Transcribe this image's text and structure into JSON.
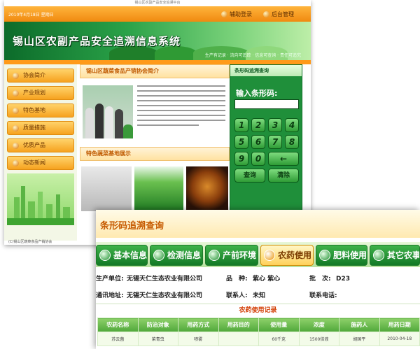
{
  "site": {
    "top_note": "锡山区农副产品安全追溯平台",
    "date": "2010年4月18日 星期日",
    "top_buttons": [
      "辅助登录",
      "后台管理"
    ],
    "banner_title": "锡山区农副产品安全追溯信息系统",
    "banner_slogan": "生产有记录 · 流向可追踪 · 信息可查询 · 责任可追究",
    "menu": [
      "协会简介",
      "产业规划",
      "特色基地",
      "质量措施",
      "优质产品",
      "动态新闻"
    ],
    "intro_title": "锡山区蔬菜食品产销协会简介",
    "base_title": "特色蔬菜基地展示",
    "query_title": "条形码追溯查询",
    "query_label": "输入条形码:",
    "keypad": [
      "1",
      "2",
      "3",
      "4",
      "5",
      "6",
      "7",
      "8",
      "9",
      "0",
      "←"
    ],
    "keypad_buttons": [
      "查询",
      "清除"
    ],
    "copyright": "(C)锡山区蔬菜食品产销协会"
  },
  "trace": {
    "title": "条形码追溯查询",
    "tabs": [
      "基本信息",
      "检测信息",
      "产前环境",
      "农药使用",
      "肥料使用",
      "其它农事"
    ],
    "active_tab": "农药使用",
    "info_rows": [
      [
        {
          "label": "生产单位:",
          "value": "无锡天仁生态农业有限公司"
        },
        {
          "label": "品　种:",
          "value": "紫心 紫心"
        },
        {
          "label": "批　次:",
          "value": "D23"
        }
      ],
      [
        {
          "label": "通讯地址:",
          "value": "无锡天仁生态农业有限公司"
        },
        {
          "label": "联系人:",
          "value": "未知"
        },
        {
          "label": "联系电话:",
          "value": ""
        }
      ]
    ],
    "records_title": "农药使用记录",
    "table": {
      "columns": [
        "农药名称",
        "防治对象",
        "用药方式",
        "用药目的",
        "使用量",
        "浓度",
        "施药人",
        "用药日期"
      ],
      "rows": [
        [
          "苏云菌",
          "菜青虫",
          "喷雾",
          "",
          "60千克",
          "1500倍液",
          "胡国平",
          "2010-04-18"
        ]
      ]
    }
  }
}
